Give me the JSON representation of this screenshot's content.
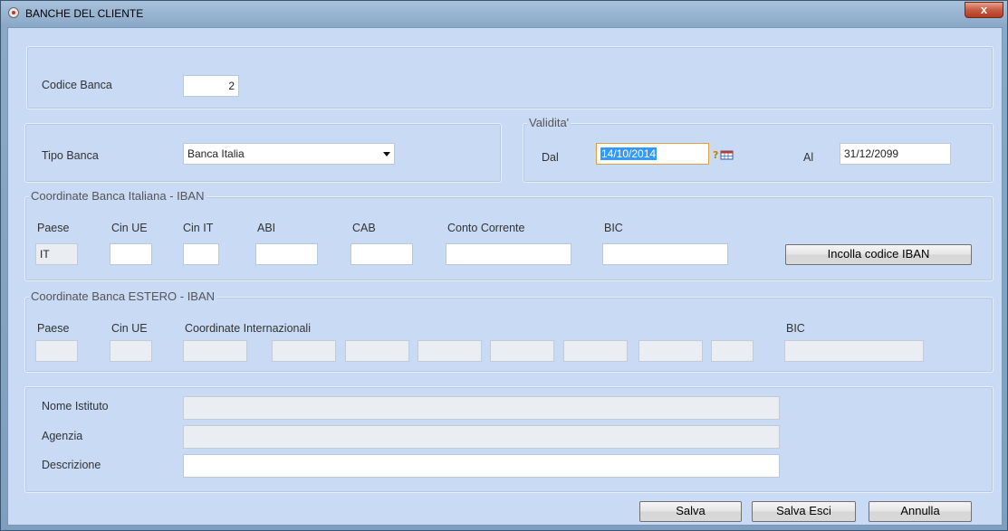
{
  "window": {
    "title": "BANCHE DEL CLIENTE",
    "close_label": "x"
  },
  "codice": {
    "label": "Codice Banca",
    "value": "2"
  },
  "tipo": {
    "label": "Tipo Banca",
    "value": "Banca Italia"
  },
  "validita": {
    "legend": "Validita'",
    "dal_label": "Dal",
    "dal_value": "14/10/2014",
    "al_label": "Al",
    "al_value": "31/12/2099"
  },
  "italiana": {
    "legend": "Coordinate Banca Italiana - IBAN",
    "headers": {
      "paese": "Paese",
      "cin_ue": "Cin UE",
      "cin_it": "Cin IT",
      "abi": "ABI",
      "cab": "CAB",
      "conto": "Conto Corrente",
      "bic": "BIC"
    },
    "values": {
      "paese": "IT",
      "cin_ue": "",
      "cin_it": "",
      "abi": "",
      "cab": "",
      "conto": "",
      "bic": ""
    },
    "paste_button": "Incolla codice IBAN"
  },
  "estero": {
    "legend": "Coordinate Banca ESTERO - IBAN",
    "headers": {
      "paese": "Paese",
      "cin_ue": "Cin UE",
      "coord": "Coordinate Internazionali",
      "bic": "BIC"
    }
  },
  "istituto": {
    "nome_label": "Nome Istituto",
    "nome_value": "",
    "agenzia_label": "Agenzia",
    "agenzia_value": "",
    "descrizione_label": "Descrizione",
    "descrizione_value": ""
  },
  "buttons": {
    "salva": "Salva",
    "salva_esci": "Salva Esci",
    "annulla": "Annulla"
  },
  "colors": {
    "client_bg": "#c8daf4",
    "close_button": "#c75b3f",
    "selection": "#3399ff"
  }
}
